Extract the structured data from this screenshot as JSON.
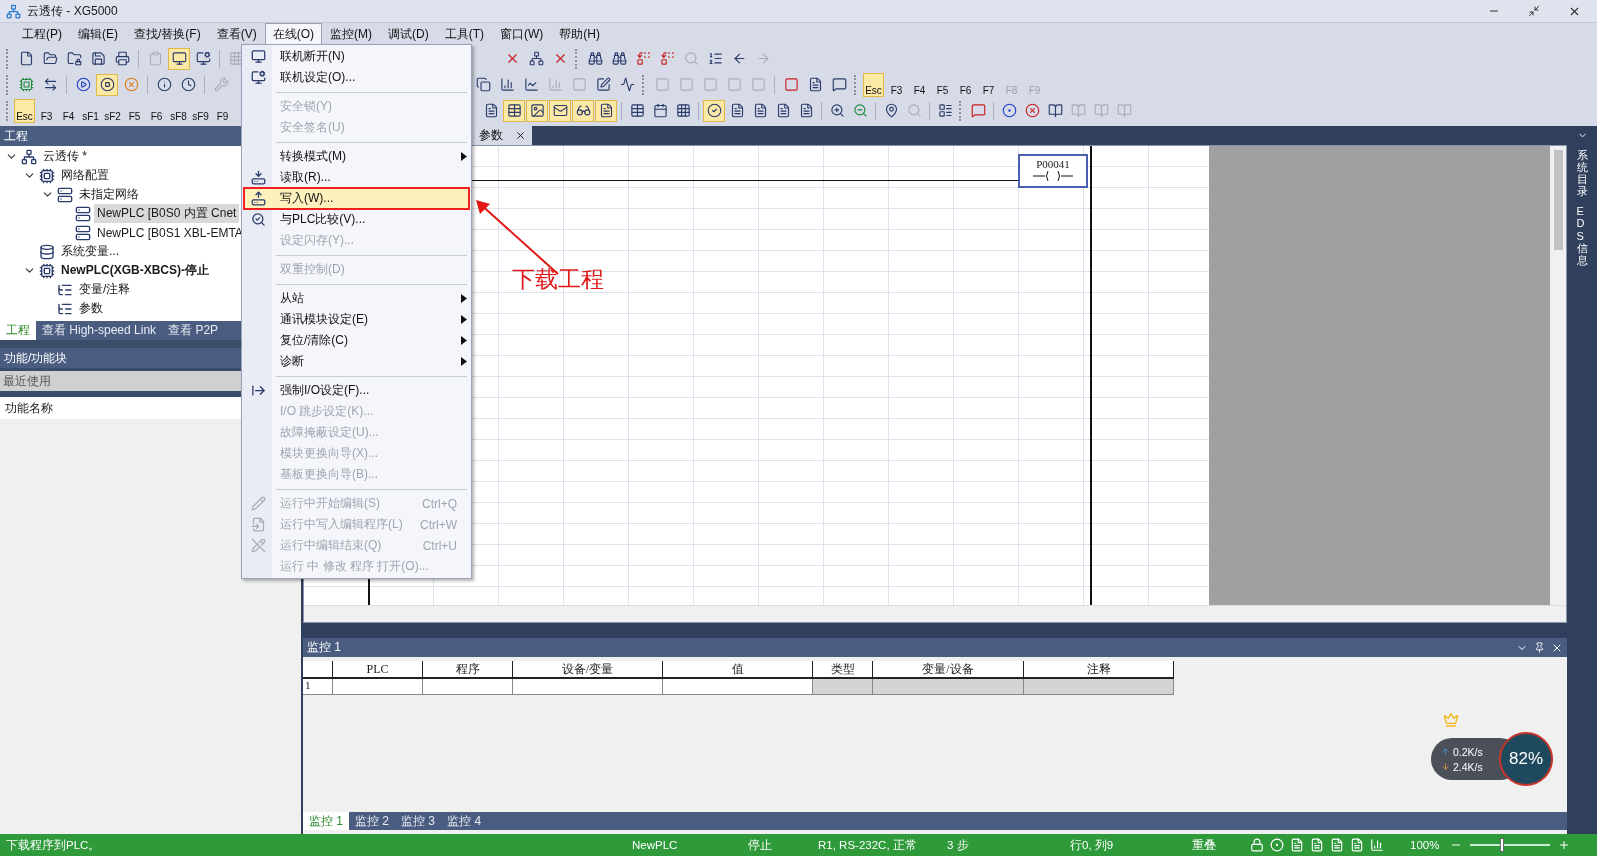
{
  "window": {
    "title": "云透传 - XG5000"
  },
  "menu_bar": [
    {
      "label": "工程(P)",
      "selected": false
    },
    {
      "label": "编辑(E)",
      "selected": false
    },
    {
      "label": "查找/替换(F)",
      "selected": false
    },
    {
      "label": "查看(V)",
      "selected": false
    },
    {
      "label": "在线(O)",
      "selected": true
    },
    {
      "label": "监控(M)",
      "selected": false
    },
    {
      "label": "调试(D)",
      "selected": false
    },
    {
      "label": "工具(T)",
      "selected": false
    },
    {
      "label": "窗口(W)",
      "selected": false
    },
    {
      "label": "帮助(H)",
      "selected": false
    }
  ],
  "toolbar_keys_upper": [
    {
      "label": "Esc",
      "selected": true,
      "disabled": false
    },
    {
      "label": "F3",
      "selected": false,
      "disabled": false
    },
    {
      "label": "F4",
      "selected": false,
      "disabled": false
    },
    {
      "label": "F5",
      "selected": false,
      "disabled": false
    },
    {
      "label": "F6",
      "selected": false,
      "disabled": false
    },
    {
      "label": "F7",
      "selected": false,
      "disabled": false
    },
    {
      "label": "F8",
      "selected": false,
      "disabled": true
    },
    {
      "label": "F9",
      "selected": false,
      "disabled": true
    }
  ],
  "toolbar_keys_lower": [
    {
      "label": "Esc",
      "selected": true,
      "disabled": false
    },
    {
      "label": "F3",
      "selected": false,
      "disabled": false
    },
    {
      "label": "F4",
      "selected": false,
      "disabled": false
    },
    {
      "label": "sF1",
      "selected": false,
      "disabled": false
    },
    {
      "label": "sF2",
      "selected": false,
      "disabled": false
    },
    {
      "label": "F5",
      "selected": false,
      "disabled": false
    },
    {
      "label": "F6",
      "selected": false,
      "disabled": false
    },
    {
      "label": "sF8",
      "selected": false,
      "disabled": false
    },
    {
      "label": "sF9",
      "selected": false,
      "disabled": false
    },
    {
      "label": "F9",
      "selected": false,
      "disabled": false
    }
  ],
  "project_panel": {
    "title": "工程",
    "tree": [
      {
        "label": "云透传 *",
        "bold": false,
        "selected": false,
        "expanded": true,
        "children": [
          {
            "label": "网络配置",
            "bold": false,
            "selected": false,
            "expanded": true,
            "children": [
              {
                "label": "未指定网络",
                "bold": false,
                "selected": false,
                "expanded": true,
                "children": [
                  {
                    "label": "NewPLC [B0S0 内置 Cnet",
                    "bold": false,
                    "selected": true
                  },
                  {
                    "label": "NewPLC [B0S1 XBL-EMTA",
                    "bold": false,
                    "selected": false
                  }
                ]
              }
            ]
          },
          {
            "label": "系统变量...",
            "bold": false,
            "selected": false
          },
          {
            "label": "NewPLC(XGB-XBCS)-停止",
            "bold": true,
            "selected": false,
            "expanded": true,
            "children": [
              {
                "label": "变量/注释",
                "bold": false,
                "selected": false
              },
              {
                "label": "参数",
                "bold": false,
                "selected": false
              }
            ]
          }
        ]
      }
    ],
    "tabs": [
      {
        "label": "工程",
        "selected": true
      },
      {
        "label": "查看 High-speed Link",
        "selected": false
      },
      {
        "label": "查看 P2P",
        "selected": false
      }
    ]
  },
  "function_panel": {
    "title": "功能/功能块",
    "recent": "最近使用",
    "column": "功能名称"
  },
  "editor": {
    "tab": "参数",
    "coil": "P00041"
  },
  "annotation": {
    "text": "下载工程"
  },
  "online_menu": [
    {
      "kind": "item",
      "label": "联机断开(N)",
      "disabled": false
    },
    {
      "kind": "item",
      "label": "联机设定(O)...",
      "disabled": false
    },
    {
      "kind": "separator"
    },
    {
      "kind": "item",
      "label": "安全锁(Y)",
      "disabled": true
    },
    {
      "kind": "item",
      "label": "安全签名(U)",
      "disabled": true
    },
    {
      "kind": "separator"
    },
    {
      "kind": "submenu",
      "label": "转换模式(M)",
      "disabled": false
    },
    {
      "kind": "item",
      "label": "读取(R)...",
      "disabled": false
    },
    {
      "kind": "item",
      "label": "写入(W)...",
      "disabled": false,
      "selected": true,
      "outlined": true
    },
    {
      "kind": "item",
      "label": "与PLC比较(V)...",
      "disabled": false
    },
    {
      "kind": "item",
      "label": "设定闪存(Y)...",
      "disabled": true
    },
    {
      "kind": "separator"
    },
    {
      "kind": "item",
      "label": "双重控制(D)",
      "disabled": true
    },
    {
      "kind": "separator"
    },
    {
      "kind": "submenu",
      "label": "从站",
      "disabled": false
    },
    {
      "kind": "submenu",
      "label": "通讯模块设定(E)",
      "disabled": false
    },
    {
      "kind": "submenu",
      "label": "复位/清除(C)",
      "disabled": false
    },
    {
      "kind": "submenu",
      "label": "诊断",
      "disabled": false
    },
    {
      "kind": "separator"
    },
    {
      "kind": "item",
      "label": "强制I/O设定(F)...",
      "disabled": false
    },
    {
      "kind": "item",
      "label": "I/O 跳步设定(K)...",
      "disabled": true
    },
    {
      "kind": "item",
      "label": "故障掩蔽设定(U)...",
      "disabled": true
    },
    {
      "kind": "item",
      "label": "模块更换向导(X)...",
      "disabled": true
    },
    {
      "kind": "item",
      "label": "基板更换向导(B)...",
      "disabled": true
    },
    {
      "kind": "separator"
    },
    {
      "kind": "item",
      "label": "运行中开始编辑(S)",
      "shortcut": "Ctrl+Q",
      "disabled": true
    },
    {
      "kind": "item",
      "label": "运行中写入编辑程序(L)",
      "shortcut": "Ctrl+W",
      "disabled": true
    },
    {
      "kind": "item",
      "label": "运行中编辑结束(Q)",
      "shortcut": "Ctrl+U",
      "disabled": true
    },
    {
      "kind": "item",
      "label": "运行 中 修改 程序 打开(O)...",
      "disabled": true
    }
  ],
  "monitor": {
    "title": "监控 1",
    "columns": [
      {
        "label": "PLC",
        "readonly": false
      },
      {
        "label": "程序",
        "readonly": false
      },
      {
        "label": "设备/变量",
        "readonly": false
      },
      {
        "label": "值",
        "readonly": false
      },
      {
        "label": "类型",
        "readonly": true
      },
      {
        "label": "变量/设备",
        "readonly": true
      },
      {
        "label": "注释",
        "readonly": true
      }
    ],
    "rows": [
      {
        "number": "1"
      }
    ],
    "tabs": [
      {
        "label": "监控 1",
        "selected": true
      },
      {
        "label": "监控 2",
        "selected": false
      },
      {
        "label": "监控 3",
        "selected": false
      },
      {
        "label": "监控 4",
        "selected": false
      }
    ]
  },
  "side_strip": [
    "系统目录",
    "EDS 信息"
  ],
  "status_bar": {
    "message": "下载程序到PLC。",
    "items": [
      "NewPLC",
      "停止",
      "R1, RS-232C, 正常",
      "3 步",
      "行0, 列9",
      "重叠"
    ],
    "zoom": "100%",
    "zoom_slider": {
      "level": 0.4
    }
  },
  "net_widget": {
    "upload": "0.2K/s",
    "download": "2.4K/s",
    "usage": "82%"
  }
}
